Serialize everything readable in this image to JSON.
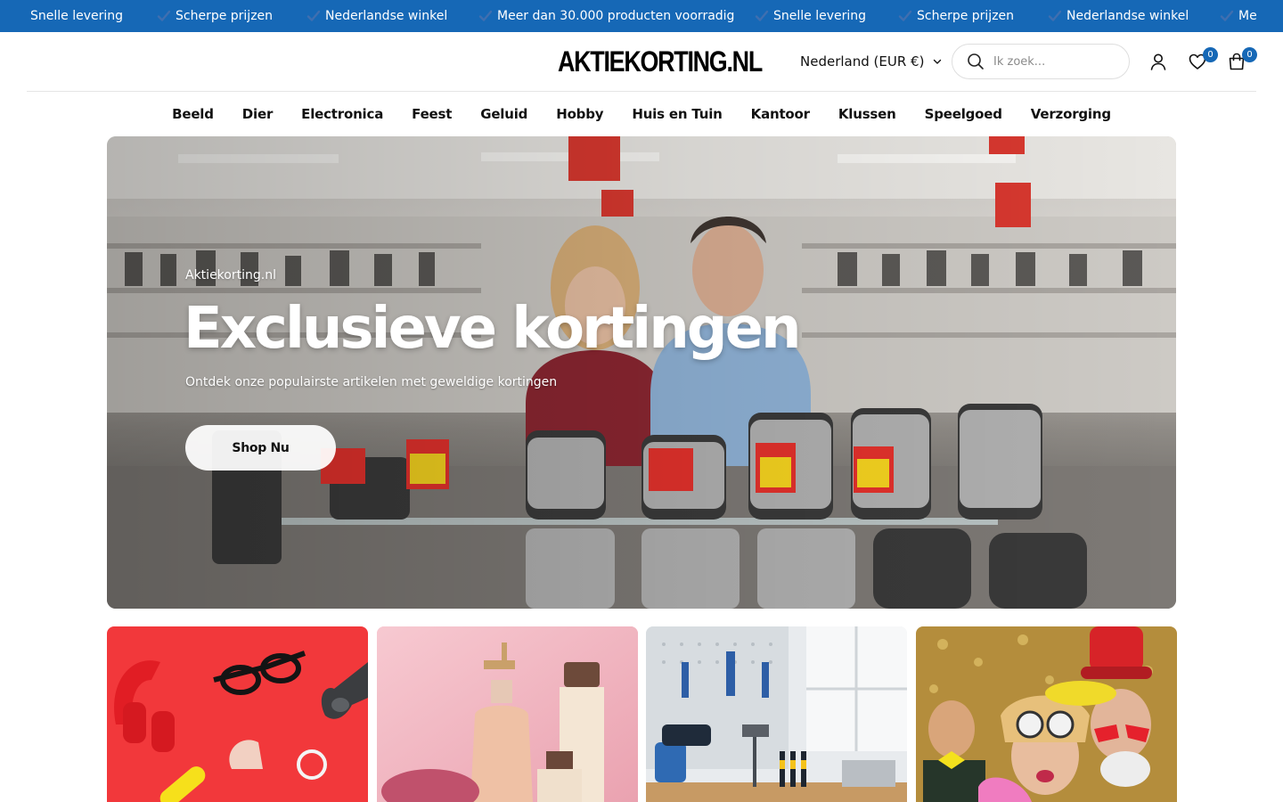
{
  "announcement": {
    "items": [
      {
        "text": "Snelle levering",
        "check": false
      },
      {
        "text": "Scherpe prijzen",
        "check": true
      },
      {
        "text": "Nederlandse winkel",
        "check": true
      },
      {
        "text": "Meer dan 30.000 producten voorradig",
        "check": true
      },
      {
        "text": "Snelle levering",
        "check": true
      },
      {
        "text": "Scherpe prijzen",
        "check": true
      },
      {
        "text": "Nederlandse winkel",
        "check": true
      },
      {
        "text": "Me",
        "check": true
      }
    ],
    "background": "#1668b6"
  },
  "header": {
    "logo": "AKTIEKORTING.NL",
    "country_selector": "Nederland (EUR €)",
    "search_placeholder": "Ik zoek...",
    "wishlist_count": "0",
    "cart_count": "0",
    "accent": "#1668b6"
  },
  "nav": {
    "items": [
      "Beeld",
      "Dier",
      "Electronica",
      "Feest",
      "Geluid",
      "Hobby",
      "Huis en Tuin",
      "Kantoor",
      "Klussen",
      "Speelgoed",
      "Verzorging"
    ]
  },
  "hero": {
    "subtitle": "Aktiekorting.nl",
    "title": "Exclusieve kortingen",
    "description": "Ontdek onze populairste artikelen met geweldige kortingen",
    "button": "Shop Nu"
  },
  "categories": {
    "tiles": [
      {
        "name": "electronics-accessories"
      },
      {
        "name": "personal-care"
      },
      {
        "name": "tools"
      },
      {
        "name": "party"
      }
    ]
  }
}
